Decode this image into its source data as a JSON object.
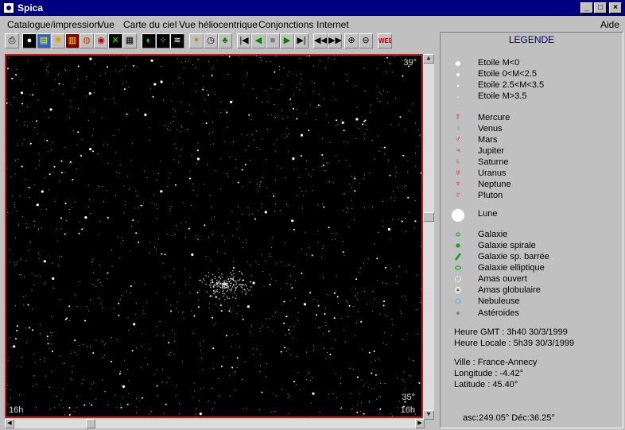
{
  "window": {
    "title": "Spica"
  },
  "menu": {
    "items": [
      {
        "label": "Catalogue/impression"
      },
      {
        "label": "Vue"
      },
      {
        "label": "Carte du ciel"
      },
      {
        "label": "Vue héliocentrique"
      },
      {
        "label": "Conjonctions"
      },
      {
        "label": "Internet"
      }
    ],
    "help": "Aide"
  },
  "toolbar": {
    "web_label": "WEB"
  },
  "map": {
    "top_right": "39°",
    "bottom_right_angle": "35°",
    "bottom_left": "16h",
    "bottom_right": "16h"
  },
  "legend": {
    "title": "LEGENDE",
    "stars": [
      "Etoile M<0",
      "Etoile 0<M<2.5",
      "Etoile 2.5<M<3.5",
      "Etoile M>3.5"
    ],
    "planets": [
      {
        "label": "Mercure",
        "color": "#e01010"
      },
      {
        "label": "Venus",
        "color": "#20b0e0"
      },
      {
        "label": "Mars",
        "color": "#e01010"
      },
      {
        "label": "Jupiter",
        "color": "#e01010"
      },
      {
        "label": "Saturne",
        "color": "#e01010"
      },
      {
        "label": "Uranus",
        "color": "#e01010"
      },
      {
        "label": "Neptune",
        "color": "#e01010"
      },
      {
        "label": "Pluton",
        "color": "#e01010"
      }
    ],
    "moon": "Lune",
    "objects": [
      {
        "label": "Galaxie",
        "color": "#10a010"
      },
      {
        "label": "Galaxie spirale",
        "color": "#10a010"
      },
      {
        "label": "Galaxie sp. barrée",
        "color": "#10a010"
      },
      {
        "label": "Galaxie elliptique",
        "color": "#10a010"
      },
      {
        "label": "Amas ouvert",
        "color": "#ffffff"
      },
      {
        "label": "Amas globulaire",
        "color": "#ffffff"
      },
      {
        "label": "Nebuleuse",
        "color": "#40c0e0"
      },
      {
        "label": "Astéroides",
        "color": "#808080"
      }
    ],
    "time_gmt": "Heure GMT : 3h40 30/3/1999",
    "time_local": "Heure Locale : 5h39 30/3/1999",
    "city": "Ville : France-Annecy",
    "longitude": "Longitude : -4.42°",
    "latitude": "Latitude : 45.40°",
    "coords": "asc:249.05° Déc:36.25°"
  }
}
